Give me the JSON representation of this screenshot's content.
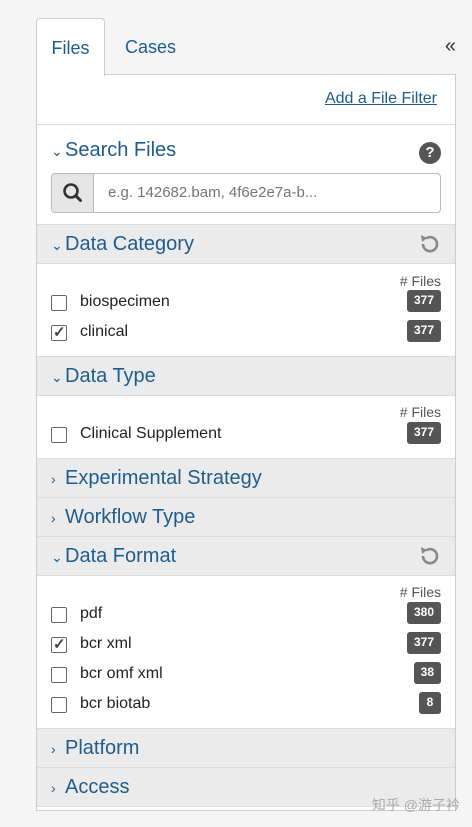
{
  "tabs": [
    {
      "label": "Files"
    },
    {
      "label": "Cases"
    }
  ],
  "collapse_label": "«",
  "add_filter_label": "Add a File Filter",
  "search": {
    "title": "Search Files",
    "placeholder": "e.g. 142682.bam, 4f6e2e7a-b..."
  },
  "files_label": "# Files",
  "facets": {
    "data_category": {
      "title": "Data Category",
      "items": [
        {
          "label": "biospecimen",
          "count": "377",
          "checked": false
        },
        {
          "label": "clinical",
          "count": "377",
          "checked": true
        }
      ]
    },
    "data_type": {
      "title": "Data Type",
      "items": [
        {
          "label": "Clinical Supplement",
          "count": "377",
          "checked": false
        }
      ]
    },
    "experimental_strategy": {
      "title": "Experimental Strategy"
    },
    "workflow_type": {
      "title": "Workflow Type"
    },
    "data_format": {
      "title": "Data Format",
      "items": [
        {
          "label": "pdf",
          "count": "380",
          "checked": false
        },
        {
          "label": "bcr xml",
          "count": "377",
          "checked": true
        },
        {
          "label": "bcr omf xml",
          "count": "38",
          "checked": false
        },
        {
          "label": "bcr biotab",
          "count": "8",
          "checked": false
        }
      ]
    },
    "platform": {
      "title": "Platform"
    },
    "access": {
      "title": "Access"
    }
  },
  "watermark": "知乎 @游子衿",
  "colors": {
    "accent": "#1f5c8c",
    "badge": "#555555",
    "header_bg": "#ebebeb"
  }
}
